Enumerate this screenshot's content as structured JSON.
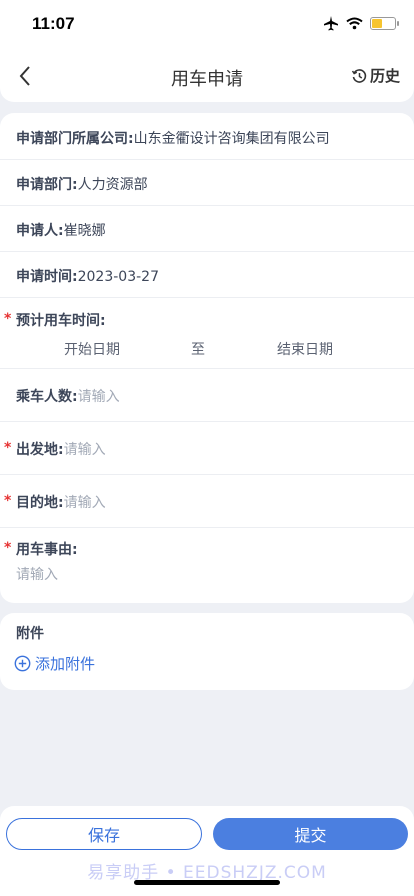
{
  "status_bar": {
    "time": "11:07"
  },
  "header": {
    "title": "用车申请",
    "history_label": "历史"
  },
  "form": {
    "company": {
      "label": "申请部门所属公司:",
      "value": "山东金衢设计咨询集团有限公司"
    },
    "department": {
      "label": "申请部门:",
      "value": "人力资源部"
    },
    "applicant": {
      "label": "申请人:",
      "value": "崔晓娜"
    },
    "apply_time": {
      "label": "申请时间:",
      "value": "2023-03-27"
    },
    "use_time": {
      "label": "预计用车时间:",
      "start_placeholder": "开始日期",
      "separator": "至",
      "end_placeholder": "结束日期"
    },
    "passengers": {
      "label": "乘车人数:",
      "placeholder": "请输入"
    },
    "departure": {
      "label": "出发地:",
      "placeholder": "请输入"
    },
    "destination": {
      "label": "目的地:",
      "placeholder": "请输入"
    },
    "reason": {
      "label": "用车事由:",
      "placeholder": "请输入"
    },
    "required_mark": "*"
  },
  "attachments": {
    "title": "附件",
    "add_label": "添加附件"
  },
  "actions": {
    "save_label": "保存",
    "submit_label": "提交"
  },
  "watermark": "易享助手 • EEDSHZJZ.COM",
  "colors": {
    "accent": "#4b7fe0",
    "required": "#e63333",
    "battery": "#f6c42f"
  },
  "icons": [
    "airplane-icon",
    "wifi-icon",
    "battery-icon",
    "back-chevron-icon",
    "history-icon",
    "add-circle-icon"
  ]
}
